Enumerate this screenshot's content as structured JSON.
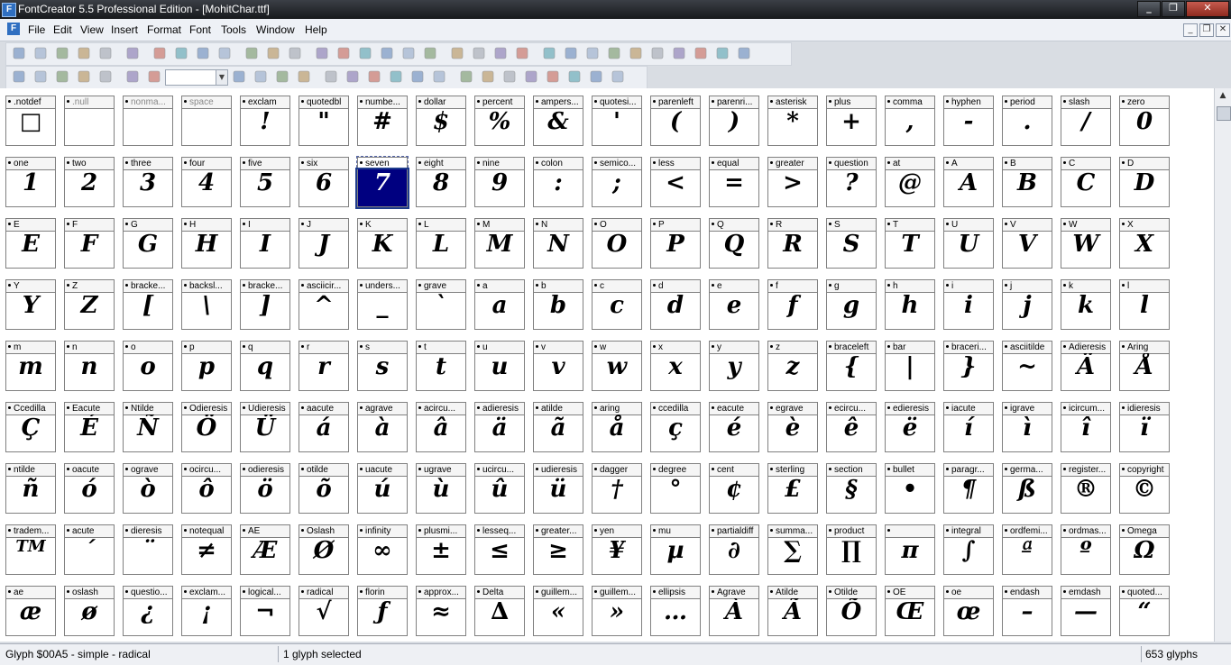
{
  "window": {
    "title": "FontCreator 5.5 Professional Edition - [MohitChar.ttf]"
  },
  "menu": [
    "File",
    "Edit",
    "View",
    "Insert",
    "Format",
    "Font",
    "Tools",
    "Window",
    "Help"
  ],
  "toolbar_icons": {
    "row1": [
      "new-icon",
      "open-icon",
      "save-icon",
      "save-all-icon",
      "open-folder-icon",
      "print-icon",
      "find-icon",
      "cut-icon",
      "copy-icon",
      "paste-icon",
      "undo-icon",
      "redo-icon",
      "refresh-icon",
      "add-glyph-icon",
      "new-glyph-icon",
      "validate-icon",
      "text-icon",
      "export-icon",
      "check-icon",
      "test-font-icon",
      "insert-character-icon",
      "list-icon",
      "edit-icon",
      "transform-icon",
      "properties-icon",
      "settings-icon",
      "align-left-icon",
      "align-center-icon",
      "align-right-icon",
      "flip-icon",
      "combine-icon",
      "group-icon",
      "ungroup-icon"
    ],
    "row2": [
      "select-icon",
      "lasso-icon",
      "hand-icon",
      "pen-icon",
      "brush-icon",
      "zoom-in-icon",
      "zoom-out-icon",
      "zoom-select",
      "grid-icon",
      "snap-icon",
      "pointer-icon",
      "node-icon",
      "image-icon",
      "line-icon",
      "rectangle-icon",
      "ellipse-icon",
      "previous-icon",
      "next-icon",
      "metrics-icon",
      "table-icon",
      "dotted-grid-icon",
      "guidelines-icon",
      "measure-icon",
      "kerning-icon",
      "hint-icon",
      "overlap-icon"
    ]
  },
  "glyph_cells": [
    {
      "name": ".notdef",
      "char": "□",
      "empty": false
    },
    {
      "name": ".null",
      "char": "",
      "empty": true
    },
    {
      "name": "nonma...",
      "char": "",
      "empty": true
    },
    {
      "name": "space",
      "char": "",
      "empty": true
    },
    {
      "name": "exclam",
      "char": "!",
      "empty": false
    },
    {
      "name": "quotedbl",
      "char": "\"",
      "empty": false
    },
    {
      "name": "numbe...",
      "char": "#",
      "empty": false
    },
    {
      "name": "dollar",
      "char": "$",
      "empty": false
    },
    {
      "name": "percent",
      "char": "%",
      "empty": false
    },
    {
      "name": "ampers...",
      "char": "&",
      "empty": false
    },
    {
      "name": "quotesi...",
      "char": "'",
      "empty": false
    },
    {
      "name": "parenleft",
      "char": "(",
      "empty": false
    },
    {
      "name": "parenri...",
      "char": ")",
      "empty": false
    },
    {
      "name": "asterisk",
      "char": "*",
      "empty": false
    },
    {
      "name": "plus",
      "char": "+",
      "empty": false
    },
    {
      "name": "comma",
      "char": ",",
      "empty": false
    },
    {
      "name": "hyphen",
      "char": "-",
      "empty": false
    },
    {
      "name": "period",
      "char": ".",
      "empty": false
    },
    {
      "name": "slash",
      "char": "/",
      "empty": false
    },
    {
      "name": "zero",
      "char": "0",
      "empty": false
    },
    {
      "name": "one",
      "char": "1",
      "empty": false
    },
    {
      "name": "two",
      "char": "2",
      "empty": false
    },
    {
      "name": "three",
      "char": "3",
      "empty": false
    },
    {
      "name": "four",
      "char": "4",
      "empty": false
    },
    {
      "name": "five",
      "char": "5",
      "empty": false
    },
    {
      "name": "six",
      "char": "6",
      "empty": false
    },
    {
      "name": "seven",
      "char": "7",
      "empty": false,
      "selected": true
    },
    {
      "name": "eight",
      "char": "8",
      "empty": false
    },
    {
      "name": "nine",
      "char": "9",
      "empty": false
    },
    {
      "name": "colon",
      "char": ":",
      "empty": false
    },
    {
      "name": "semico...",
      "char": ";",
      "empty": false
    },
    {
      "name": "less",
      "char": "<",
      "empty": false
    },
    {
      "name": "equal",
      "char": "=",
      "empty": false
    },
    {
      "name": "greater",
      "char": ">",
      "empty": false
    },
    {
      "name": "question",
      "char": "?",
      "empty": false
    },
    {
      "name": "at",
      "char": "@",
      "empty": false
    },
    {
      "name": "A",
      "char": "A",
      "empty": false
    },
    {
      "name": "B",
      "char": "B",
      "empty": false
    },
    {
      "name": "C",
      "char": "C",
      "empty": false
    },
    {
      "name": "D",
      "char": "D",
      "empty": false
    },
    {
      "name": "E",
      "char": "E",
      "empty": false
    },
    {
      "name": "F",
      "char": "F",
      "empty": false
    },
    {
      "name": "G",
      "char": "G",
      "empty": false
    },
    {
      "name": "H",
      "char": "H",
      "empty": false
    },
    {
      "name": "I",
      "char": "I",
      "empty": false
    },
    {
      "name": "J",
      "char": "J",
      "empty": false
    },
    {
      "name": "K",
      "char": "K",
      "empty": false
    },
    {
      "name": "L",
      "char": "L",
      "empty": false
    },
    {
      "name": "M",
      "char": "M",
      "empty": false
    },
    {
      "name": "N",
      "char": "N",
      "empty": false
    },
    {
      "name": "O",
      "char": "O",
      "empty": false
    },
    {
      "name": "P",
      "char": "P",
      "empty": false
    },
    {
      "name": "Q",
      "char": "Q",
      "empty": false
    },
    {
      "name": "R",
      "char": "R",
      "empty": false
    },
    {
      "name": "S",
      "char": "S",
      "empty": false
    },
    {
      "name": "T",
      "char": "T",
      "empty": false
    },
    {
      "name": "U",
      "char": "U",
      "empty": false
    },
    {
      "name": "V",
      "char": "V",
      "empty": false
    },
    {
      "name": "W",
      "char": "W",
      "empty": false
    },
    {
      "name": "X",
      "char": "X",
      "empty": false
    },
    {
      "name": "Y",
      "char": "Y",
      "empty": false
    },
    {
      "name": "Z",
      "char": "Z",
      "empty": false
    },
    {
      "name": "bracke...",
      "char": "[",
      "empty": false
    },
    {
      "name": "backsl...",
      "char": "\\",
      "empty": false
    },
    {
      "name": "bracke...",
      "char": "]",
      "empty": false
    },
    {
      "name": "asciicir...",
      "char": "^",
      "empty": false
    },
    {
      "name": "unders...",
      "char": "_",
      "empty": false
    },
    {
      "name": "grave",
      "char": "`",
      "empty": false
    },
    {
      "name": "a",
      "char": "a",
      "empty": false
    },
    {
      "name": "b",
      "char": "b",
      "empty": false
    },
    {
      "name": "c",
      "char": "c",
      "empty": false
    },
    {
      "name": "d",
      "char": "d",
      "empty": false
    },
    {
      "name": "e",
      "char": "e",
      "empty": false
    },
    {
      "name": "f",
      "char": "f",
      "empty": false
    },
    {
      "name": "g",
      "char": "g",
      "empty": false
    },
    {
      "name": "h",
      "char": "h",
      "empty": false
    },
    {
      "name": "i",
      "char": "i",
      "empty": false
    },
    {
      "name": "j",
      "char": "j",
      "empty": false
    },
    {
      "name": "k",
      "char": "k",
      "empty": false
    },
    {
      "name": "l",
      "char": "l",
      "empty": false
    },
    {
      "name": "m",
      "char": "m",
      "empty": false
    },
    {
      "name": "n",
      "char": "n",
      "empty": false
    },
    {
      "name": "o",
      "char": "o",
      "empty": false
    },
    {
      "name": "p",
      "char": "p",
      "empty": false
    },
    {
      "name": "q",
      "char": "q",
      "empty": false
    },
    {
      "name": "r",
      "char": "r",
      "empty": false
    },
    {
      "name": "s",
      "char": "s",
      "empty": false
    },
    {
      "name": "t",
      "char": "t",
      "empty": false
    },
    {
      "name": "u",
      "char": "u",
      "empty": false
    },
    {
      "name": "v",
      "char": "v",
      "empty": false
    },
    {
      "name": "w",
      "char": "w",
      "empty": false
    },
    {
      "name": "x",
      "char": "x",
      "empty": false
    },
    {
      "name": "y",
      "char": "y",
      "empty": false
    },
    {
      "name": "z",
      "char": "z",
      "empty": false
    },
    {
      "name": "braceleft",
      "char": "{",
      "empty": false
    },
    {
      "name": "bar",
      "char": "|",
      "empty": false
    },
    {
      "name": "braceri...",
      "char": "}",
      "empty": false
    },
    {
      "name": "asciitilde",
      "char": "~",
      "empty": false
    },
    {
      "name": "Adieresis",
      "char": "Ä",
      "empty": false
    },
    {
      "name": "Aring",
      "char": "Å",
      "empty": false
    },
    {
      "name": "Ccedilla",
      "char": "Ç",
      "empty": false
    },
    {
      "name": "Eacute",
      "char": "É",
      "empty": false
    },
    {
      "name": "Ntilde",
      "char": "Ñ",
      "empty": false
    },
    {
      "name": "Odieresis",
      "char": "Ö",
      "empty": false
    },
    {
      "name": "Udieresis",
      "char": "Ü",
      "empty": false
    },
    {
      "name": "aacute",
      "char": "á",
      "empty": false
    },
    {
      "name": "agrave",
      "char": "à",
      "empty": false
    },
    {
      "name": "acircu...",
      "char": "â",
      "empty": false
    },
    {
      "name": "adieresis",
      "char": "ä",
      "empty": false
    },
    {
      "name": "atilde",
      "char": "ã",
      "empty": false
    },
    {
      "name": "aring",
      "char": "å",
      "empty": false
    },
    {
      "name": "ccedilla",
      "char": "ç",
      "empty": false
    },
    {
      "name": "eacute",
      "char": "é",
      "empty": false
    },
    {
      "name": "egrave",
      "char": "è",
      "empty": false
    },
    {
      "name": "ecircu...",
      "char": "ê",
      "empty": false
    },
    {
      "name": "edieresis",
      "char": "ë",
      "empty": false
    },
    {
      "name": "iacute",
      "char": "í",
      "empty": false
    },
    {
      "name": "igrave",
      "char": "ì",
      "empty": false
    },
    {
      "name": "icircum...",
      "char": "î",
      "empty": false
    },
    {
      "name": "idieresis",
      "char": "ï",
      "empty": false
    },
    {
      "name": "ntilde",
      "char": "ñ",
      "empty": false
    },
    {
      "name": "oacute",
      "char": "ó",
      "empty": false
    },
    {
      "name": "ograve",
      "char": "ò",
      "empty": false
    },
    {
      "name": "ocircu...",
      "char": "ô",
      "empty": false
    },
    {
      "name": "odieresis",
      "char": "ö",
      "empty": false
    },
    {
      "name": "otilde",
      "char": "õ",
      "empty": false
    },
    {
      "name": "uacute",
      "char": "ú",
      "empty": false
    },
    {
      "name": "ugrave",
      "char": "ù",
      "empty": false
    },
    {
      "name": "ucircu...",
      "char": "û",
      "empty": false
    },
    {
      "name": "udieresis",
      "char": "ü",
      "empty": false
    },
    {
      "name": "dagger",
      "char": "†",
      "empty": false
    },
    {
      "name": "degree",
      "char": "°",
      "empty": false
    },
    {
      "name": "cent",
      "char": "¢",
      "empty": false
    },
    {
      "name": "sterling",
      "char": "£",
      "empty": false
    },
    {
      "name": "section",
      "char": "§",
      "empty": false
    },
    {
      "name": "bullet",
      "char": "•",
      "empty": false
    },
    {
      "name": "paragr...",
      "char": "¶",
      "empty": false
    },
    {
      "name": "germa...",
      "char": "ß",
      "empty": false
    },
    {
      "name": "register...",
      "char": "®",
      "empty": false
    },
    {
      "name": "copyright",
      "char": "©",
      "empty": false
    },
    {
      "name": "tradem...",
      "char": "TM",
      "empty": false
    },
    {
      "name": "acute",
      "char": "´",
      "empty": false
    },
    {
      "name": "dieresis",
      "char": "¨",
      "empty": false
    },
    {
      "name": "notequal",
      "char": "≠",
      "empty": false
    },
    {
      "name": "AE",
      "char": "Æ",
      "empty": false
    },
    {
      "name": "Oslash",
      "char": "Ø",
      "empty": false
    },
    {
      "name": "infinity",
      "char": "∞",
      "empty": false
    },
    {
      "name": "plusmi...",
      "char": "±",
      "empty": false
    },
    {
      "name": "lesseq...",
      "char": "≤",
      "empty": false
    },
    {
      "name": "greater...",
      "char": "≥",
      "empty": false
    },
    {
      "name": "yen",
      "char": "¥",
      "empty": false
    },
    {
      "name": "mu",
      "char": "µ",
      "empty": false
    },
    {
      "name": "partialdiff",
      "char": "∂",
      "empty": false
    },
    {
      "name": "summa...",
      "char": "∑",
      "empty": false
    },
    {
      "name": "product",
      "char": "∏",
      "empty": false
    },
    {
      "name": "",
      "char": "π",
      "empty": false
    },
    {
      "name": "integral",
      "char": "∫",
      "empty": false
    },
    {
      "name": "ordfemi...",
      "char": "ª",
      "empty": false
    },
    {
      "name": "ordmas...",
      "char": "º",
      "empty": false
    },
    {
      "name": "Omega",
      "char": "Ω",
      "empty": false
    },
    {
      "name": "ae",
      "char": "æ",
      "empty": false
    },
    {
      "name": "oslash",
      "char": "ø",
      "empty": false
    },
    {
      "name": "questio...",
      "char": "¿",
      "empty": false
    },
    {
      "name": "exclam...",
      "char": "¡",
      "empty": false
    },
    {
      "name": "logical...",
      "char": "¬",
      "empty": false
    },
    {
      "name": "radical",
      "char": "√",
      "empty": false
    },
    {
      "name": "florin",
      "char": "ƒ",
      "empty": false
    },
    {
      "name": "approx...",
      "char": "≈",
      "empty": false
    },
    {
      "name": "Delta",
      "char": "∆",
      "empty": false
    },
    {
      "name": "guillem...",
      "char": "«",
      "empty": false
    },
    {
      "name": "guillem...",
      "char": "»",
      "empty": false
    },
    {
      "name": "ellipsis",
      "char": "…",
      "empty": false
    },
    {
      "name": "Agrave",
      "char": "À",
      "empty": false
    },
    {
      "name": "Atilde",
      "char": "Ã",
      "empty": false
    },
    {
      "name": "Otilde",
      "char": "Õ",
      "empty": false
    },
    {
      "name": "OE",
      "char": "Œ",
      "empty": false
    },
    {
      "name": "oe",
      "char": "œ",
      "empty": false
    },
    {
      "name": "endash",
      "char": "–",
      "empty": false
    },
    {
      "name": "emdash",
      "char": "—",
      "empty": false
    },
    {
      "name": "quoted...",
      "char": "“",
      "empty": false
    }
  ],
  "status": {
    "glyph_info": "Glyph $00A5 - simple - radical",
    "selection": "1 glyph selected",
    "count": "653 glyphs"
  },
  "colors": {
    "selected_bg": "#000080",
    "title_bg": "#1f2125",
    "cell_border": "#808080"
  }
}
